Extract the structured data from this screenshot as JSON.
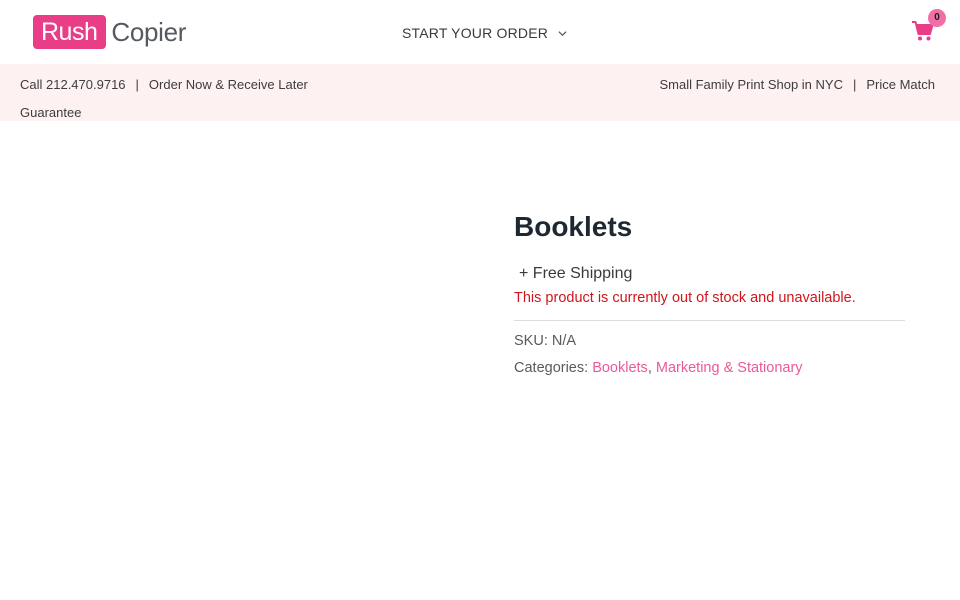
{
  "header": {
    "logo": {
      "rush": "Rush",
      "copier": "Copier"
    },
    "nav": {
      "label": "START YOUR ORDER",
      "icon": "chevron-down-icon"
    },
    "cart": {
      "icon": "shopping-cart-icon",
      "count": "0",
      "color": "#e93d87"
    }
  },
  "info_bar": {
    "phone": "Call 212.470.9716",
    "separator": "|",
    "order_note": "Order Now & Receive Later",
    "guarantee_word": "Guarantee",
    "shop": "Small Family Print Shop in NYC",
    "price_match": "Price Match"
  },
  "product": {
    "title": "Booklets",
    "shipping": "+ Free Shipping",
    "stock_message": "This product is currently out of stock and unavailable.",
    "sku_label": "SKU:",
    "sku_value": "N/A",
    "categories_label": "Categories:",
    "categories": [
      "Booklets",
      "Marketing & Stationary"
    ],
    "category_separator": ","
  },
  "colors": {
    "brand_pink": "#e93d87",
    "link_pink": "#e95a9a",
    "stock_red": "#d0161c",
    "info_bar_bg": "#fdf1f2"
  }
}
